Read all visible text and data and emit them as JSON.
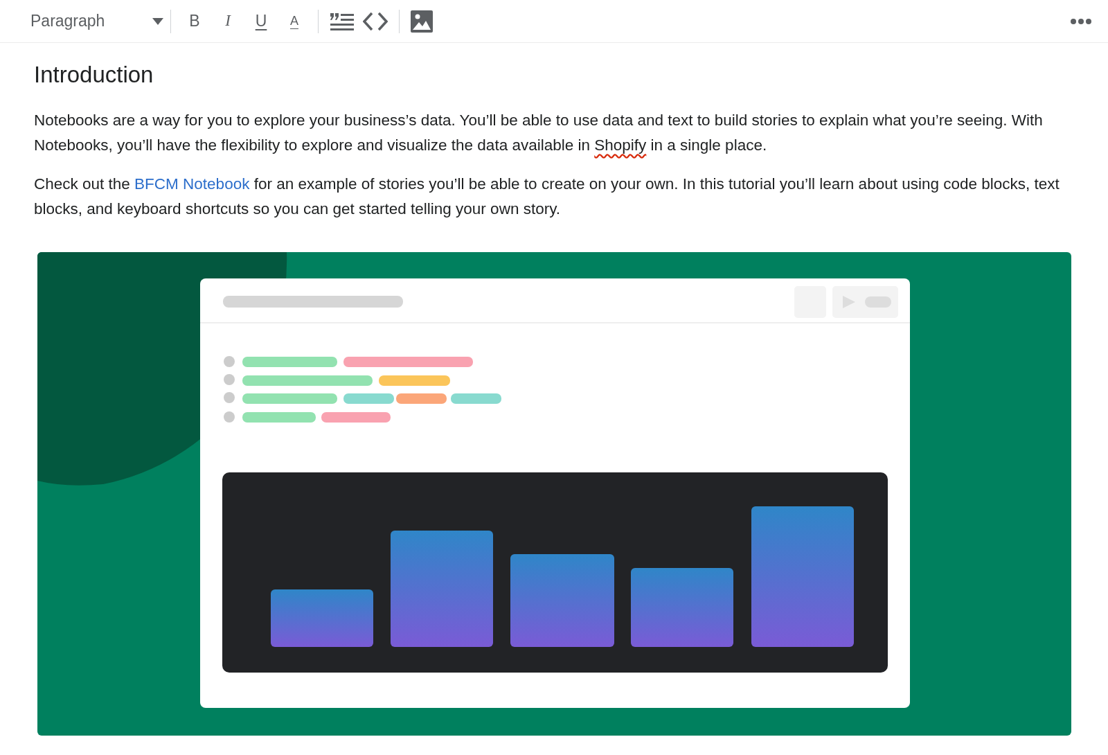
{
  "toolbar": {
    "block_style": "Paragraph",
    "format_buttons": [
      "B",
      "I",
      "U",
      "A"
    ]
  },
  "document": {
    "heading": "Introduction",
    "paragraphs": [
      [
        {
          "kind": "text",
          "text": "Notebooks are a way for you to explore your business’s data. You’ll be able to use data and text to build stories to explain what you’re seeing. With Notebooks, you’ll have the flexibility to explore and visualize the data available in "
        },
        {
          "kind": "misspelled",
          "text": "Shopify"
        },
        {
          "kind": "text",
          "text": " in a single place."
        }
      ],
      [
        {
          "kind": "text",
          "text": "Check out the "
        },
        {
          "kind": "link",
          "text": "BFCM Notebook"
        },
        {
          "kind": "text",
          "text": " for an example of stories you’ll be able to create on your own. In this tutorial you’ll learn about using code blocks, text blocks, and keyboard shortcuts so you can get started telling your own story."
        }
      ]
    ]
  }
}
